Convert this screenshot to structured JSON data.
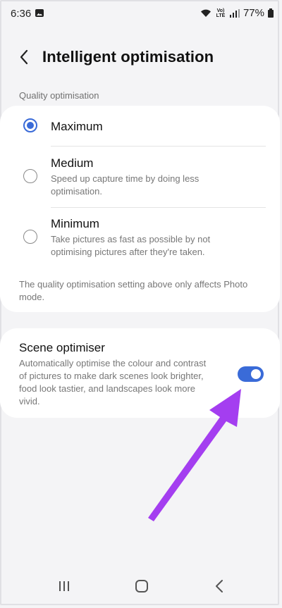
{
  "status_bar": {
    "time": "6:36",
    "volte_top": "VoLTE",
    "battery": "77%",
    "icons": [
      "gallery-icon",
      "wifi-icon",
      "volte-icon",
      "signal-icon",
      "battery-icon"
    ]
  },
  "header": {
    "title": "Intelligent optimisation",
    "back_icon": "chevron-left-icon"
  },
  "quality": {
    "section_label": "Quality optimisation",
    "options": [
      {
        "label": "Maximum",
        "description": "",
        "selected": true
      },
      {
        "label": "Medium",
        "description": "Speed up capture time by doing less optimisation.",
        "selected": false
      },
      {
        "label": "Minimum",
        "description": "Take pictures as fast as possible by not optimising pictures after they're taken.",
        "selected": false
      }
    ],
    "note": "The quality optimisation setting above only affects Photo mode."
  },
  "scene_optimiser": {
    "label": "Scene optimiser",
    "description": "Automatically optimise the colour and contrast of pictures to make dark scenes look brighter, food look tastier, and landscapes look more vivid.",
    "enabled": true
  },
  "colors": {
    "accent": "#3a6bd8",
    "annotation_arrow": "#a43ef0",
    "background": "#f4f4f6"
  },
  "nav_bar": {
    "icons": [
      "recents-icon",
      "home-icon",
      "back-icon"
    ]
  }
}
